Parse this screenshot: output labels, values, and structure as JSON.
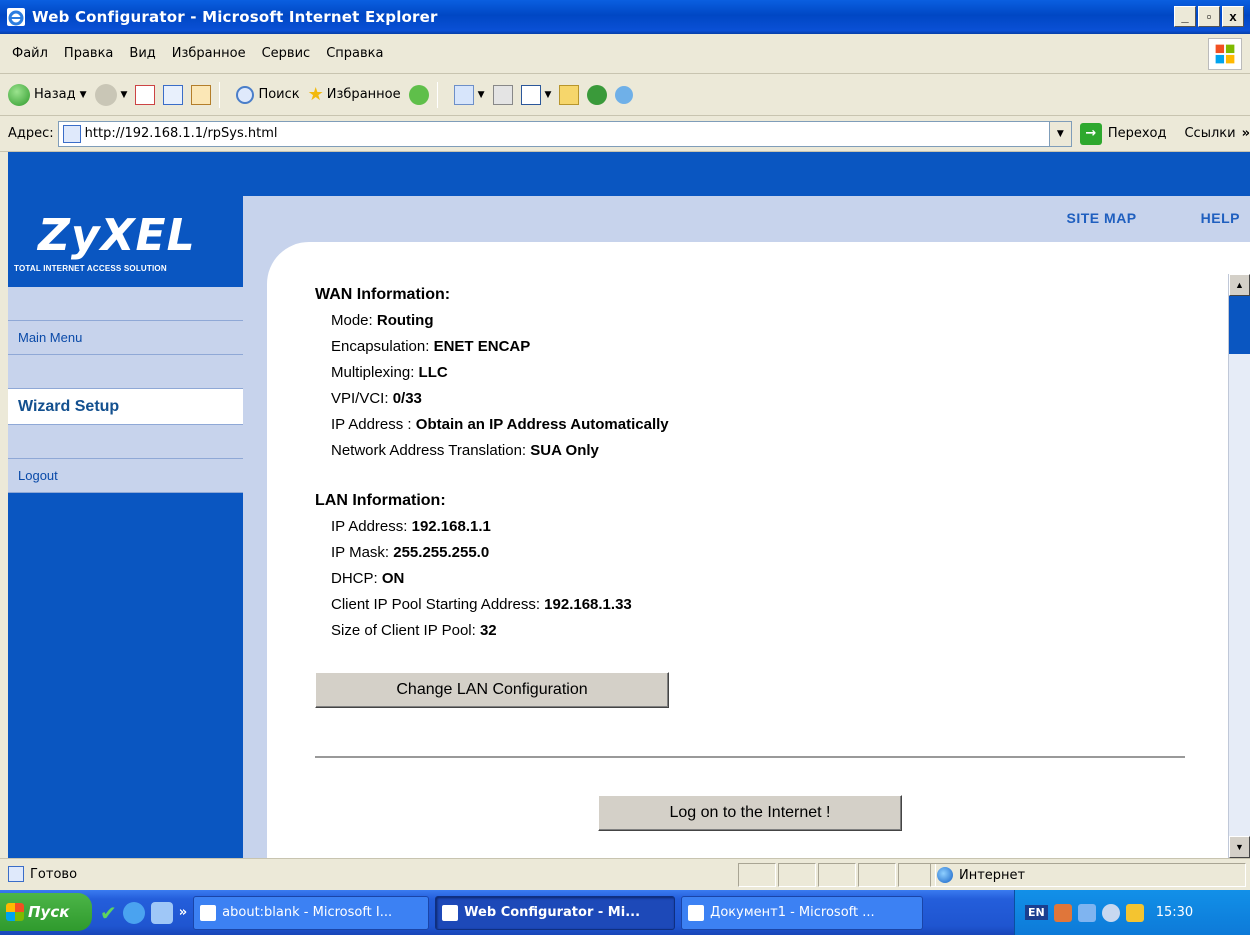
{
  "window": {
    "title": "Web Configurator - Microsoft Internet Explorer",
    "minimize": "_",
    "maximize": "▫",
    "close": "x"
  },
  "menu": [
    "Файл",
    "Правка",
    "Вид",
    "Избранное",
    "Сервис",
    "Справка"
  ],
  "toolbar": {
    "back": "Назад",
    "search": "Поиск",
    "favorites": "Избранное"
  },
  "address": {
    "label": "Адрес:",
    "url": "http://192.168.1.1/rpSys.html",
    "go": "Переход",
    "links": "Ссылки"
  },
  "brand": {
    "logo": "ZyXEL",
    "tagline": "TOTAL INTERNET ACCESS SOLUTION"
  },
  "top_links": {
    "site_map": "SITE MAP",
    "help": "HELP"
  },
  "nav": {
    "main_menu": "Main Menu",
    "wizard_setup": "Wizard Setup",
    "logout": "Logout"
  },
  "wan": {
    "title": "WAN Information:",
    "rows": [
      {
        "label": "Mode: ",
        "value": "Routing"
      },
      {
        "label": "Encapsulation: ",
        "value": "ENET ENCAP"
      },
      {
        "label": "Multiplexing: ",
        "value": "LLC"
      },
      {
        "label": "VPI/VCI: ",
        "value": "0/33"
      },
      {
        "label": "IP Address : ",
        "value": "Obtain an IP Address Automatically"
      },
      {
        "label": "Network Address Translation: ",
        "value": "SUA Only"
      }
    ]
  },
  "lan": {
    "title": "LAN Information:",
    "rows": [
      {
        "label": "IP Address: ",
        "value": "192.168.1.1"
      },
      {
        "label": "IP Mask: ",
        "value": "255.255.255.0"
      },
      {
        "label": "DHCP: ",
        "value": "ON"
      },
      {
        "label": "Client IP Pool Starting Address: ",
        "value": "192.168.1.33"
      },
      {
        "label": "Size of Client IP Pool: ",
        "value": "32"
      }
    ]
  },
  "buttons": {
    "change_lan": "Change LAN Configuration",
    "log_on": "Log on to the Internet !"
  },
  "status": {
    "text": "Готово",
    "zone": "Интернет"
  },
  "taskbar": {
    "start": "Пуск",
    "more": "»",
    "tasks": [
      "about:blank - Microsoft I...",
      "Web Configurator - Mi...",
      "Документ1 - Microsoft ..."
    ],
    "lang": "EN",
    "time": "15:30"
  },
  "colors": {
    "brand_blue": "#0a56c1",
    "panel_lilac": "#c7d3ec",
    "link_blue": "#1f5fbf"
  }
}
